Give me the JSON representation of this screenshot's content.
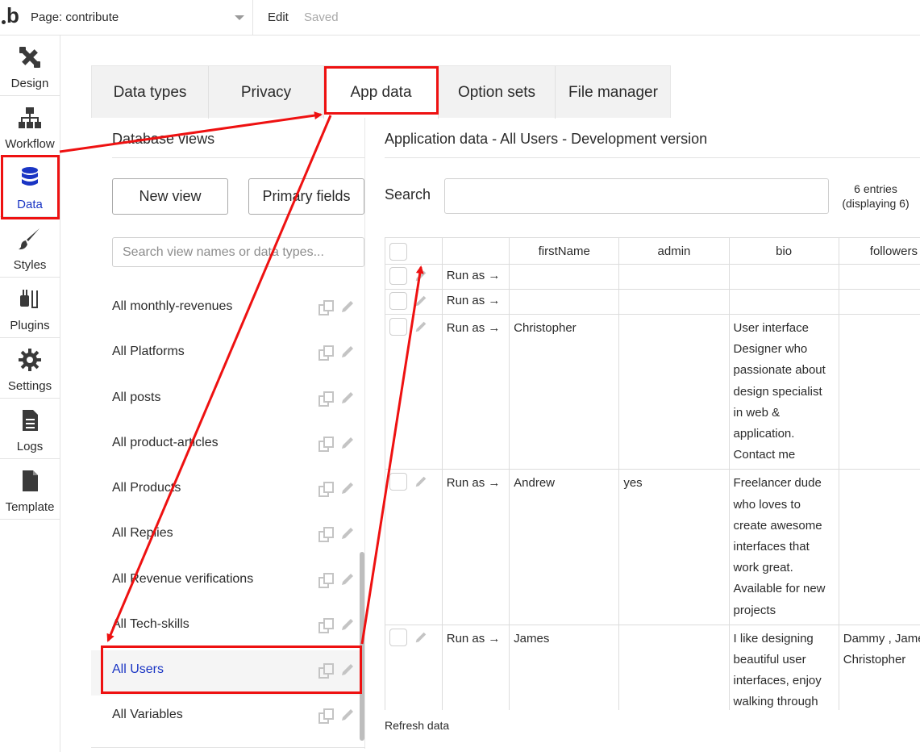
{
  "topbar": {
    "page_label": "Page: contribute",
    "edit": "Edit",
    "saved": "Saved"
  },
  "sidebar": {
    "items": [
      {
        "label": "Design",
        "icon": "design-icon"
      },
      {
        "label": "Workflow",
        "icon": "workflow-icon"
      },
      {
        "label": "Data",
        "icon": "database-icon",
        "active": true
      },
      {
        "label": "Styles",
        "icon": "brush-icon"
      },
      {
        "label": "Plugins",
        "icon": "plug-icon"
      },
      {
        "label": "Settings",
        "icon": "gear-icon"
      },
      {
        "label": "Logs",
        "icon": "document-icon"
      },
      {
        "label": "Template",
        "icon": "template-icon"
      }
    ]
  },
  "tabs": [
    {
      "label": "Data types"
    },
    {
      "label": "Privacy"
    },
    {
      "label": "App data",
      "active": true
    },
    {
      "label": "Option sets"
    },
    {
      "label": "File manager"
    }
  ],
  "database_views": {
    "title": "Database views",
    "new_view": "New view",
    "primary_fields": "Primary fields",
    "search_placeholder": "Search view names or data types...",
    "items": [
      {
        "name": "All monthly-revenues"
      },
      {
        "name": "All Platforms"
      },
      {
        "name": "All posts"
      },
      {
        "name": "All product-articles"
      },
      {
        "name": "All Products"
      },
      {
        "name": "All Replies"
      },
      {
        "name": "All Revenue verifications"
      },
      {
        "name": "All Tech-skills"
      },
      {
        "name": "All Users",
        "selected": true
      },
      {
        "name": "All Variables"
      }
    ]
  },
  "app_data": {
    "title": "Application data - All Users - Development version",
    "search_label": "Search",
    "entries_line1": "6 entries",
    "entries_line2": "(displaying 6)",
    "columns": [
      "firstName",
      "admin",
      "bio",
      "followers"
    ],
    "run_as": "Run as →",
    "rows": [
      {
        "firstName": "",
        "admin": "",
        "bio": "",
        "followers": ""
      },
      {
        "firstName": "",
        "admin": "",
        "bio": "",
        "followers": ""
      },
      {
        "firstName": "Christopher",
        "admin": "",
        "bio": "User interface Designer who passionate about design specialist in web & application. Contact me",
        "followers": ""
      },
      {
        "firstName": "Andrew",
        "admin": "yes",
        "bio": "Freelancer dude who loves to create awesome interfaces that work great. Available for new projects",
        "followers": ""
      },
      {
        "firstName": "James",
        "admin": "",
        "bio": "I like designing beautiful user interfaces, enjoy walking through the forest.",
        "followers": "Dammy , James , Christopher"
      }
    ],
    "refresh": "Refresh data"
  },
  "colors": {
    "accent": "#1a35c4",
    "annotation": "#ee1111"
  }
}
